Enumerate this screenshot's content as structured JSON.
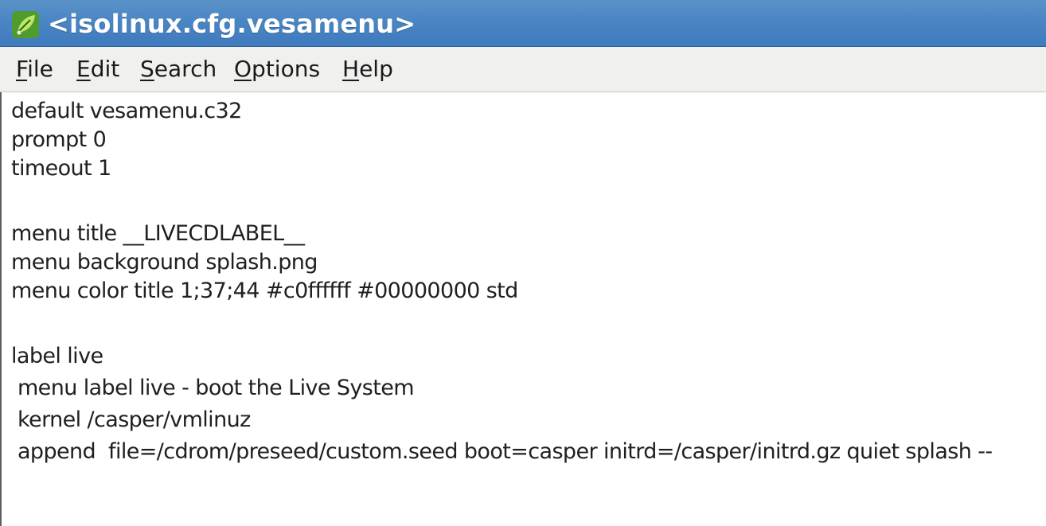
{
  "window": {
    "title": "<isolinux.cfg.vesamenu>",
    "icon": "leaf-editor-icon"
  },
  "menubar": {
    "items": [
      {
        "first": "F",
        "rest": "ile"
      },
      {
        "first": "Ed",
        "rest": "it",
        "mnemonic_pos": "i"
      },
      {
        "first": "S",
        "rest": "earch"
      },
      {
        "first": "O",
        "rest": "ptions"
      },
      {
        "first": "H",
        "rest": "elp"
      }
    ],
    "labels": [
      "File",
      "Edit",
      "Search",
      "Options",
      "Help"
    ]
  },
  "editor": {
    "lines": [
      "default vesamenu.c32",
      "prompt 0",
      "timeout 1",
      "",
      "menu title __LIVECDLABEL__",
      "menu background splash.png",
      "menu color title 1;37;44 #c0ffffff #00000000 std",
      "",
      "label live",
      " menu label live - boot the Live System",
      " kernel /casper/vmlinuz",
      " append  file=/cdrom/preseed/custom.seed boot=casper initrd=/casper/initrd.gz quiet splash --"
    ]
  },
  "colors": {
    "titlebar": "#4a86c4",
    "title_text": "#ffffff",
    "menubar": "#f0f0ef",
    "editor_bg": "#ffffff",
    "text": "#202020"
  }
}
